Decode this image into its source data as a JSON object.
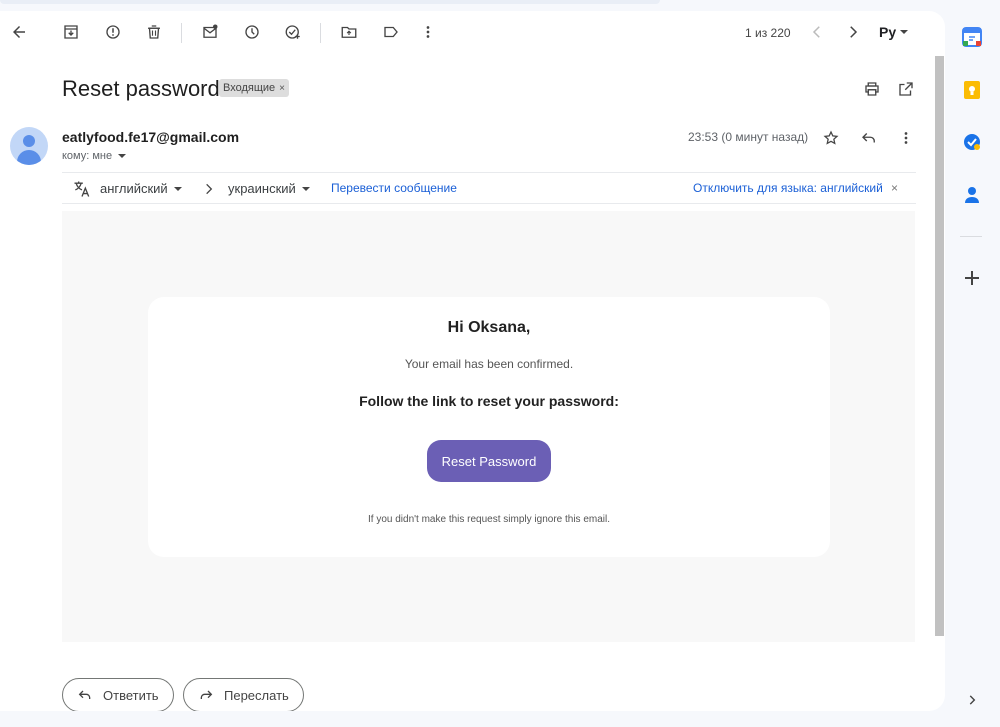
{
  "toolbar": {
    "pager_text": "1 из 220",
    "language": "Ру"
  },
  "message": {
    "subject": "Reset password",
    "label": "Входящие",
    "label_close": "×",
    "sender": "eatlyfood.fe17@gmail.com",
    "recipient": "кому: мне",
    "timestamp": "23:53 (0 минут назад)"
  },
  "translate": {
    "source_lang": "английский",
    "target_lang": "украинский",
    "translate_link": "Перевести сообщение",
    "disable_link": "Отключить для языка: английский",
    "close": "×"
  },
  "email_body": {
    "greeting": "Hi Oksana,",
    "confirmed": "Your email has been confirmed.",
    "instruction": "Follow the link to reset your password:",
    "button": "Reset Password",
    "footer": "If you didn't make this request simply ignore this email."
  },
  "actions": {
    "reply": "Ответить",
    "forward": "Переслать"
  },
  "colors": {
    "accent_button": "#6b5fb5",
    "link": "#1a5fd6"
  }
}
